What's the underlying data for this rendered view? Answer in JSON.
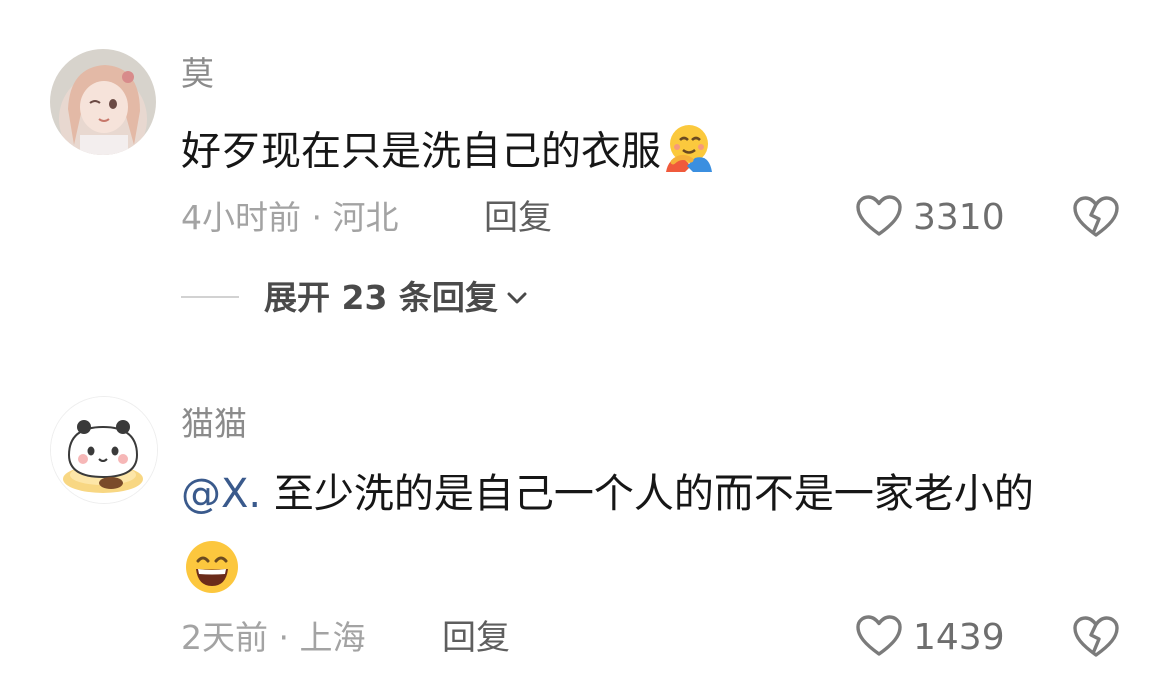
{
  "comments": [
    {
      "username": "莫",
      "text": "好歹现在只是洗自己的衣服",
      "emoji": "hugging-face-emoji",
      "meta": "4小时前 · 河北",
      "reply_label": "回复",
      "likes": "3310",
      "expand_label": "展开 23 条回复"
    },
    {
      "username": "猫猫",
      "mention": "@X.",
      "text": "至少洗的是自己一个人的而不是一家老小的",
      "emoji": "grinning-face-emoji",
      "meta": "2天前 · 上海",
      "reply_label": "回复",
      "likes": "1439"
    }
  ],
  "icons": {
    "like": "heart-outline-icon",
    "dislike": "broken-heart-icon",
    "expand": "chevron-down-icon"
  },
  "colors": {
    "mention": "#3a5a8c",
    "meta": "#a3a3a3",
    "text": "#161616"
  }
}
